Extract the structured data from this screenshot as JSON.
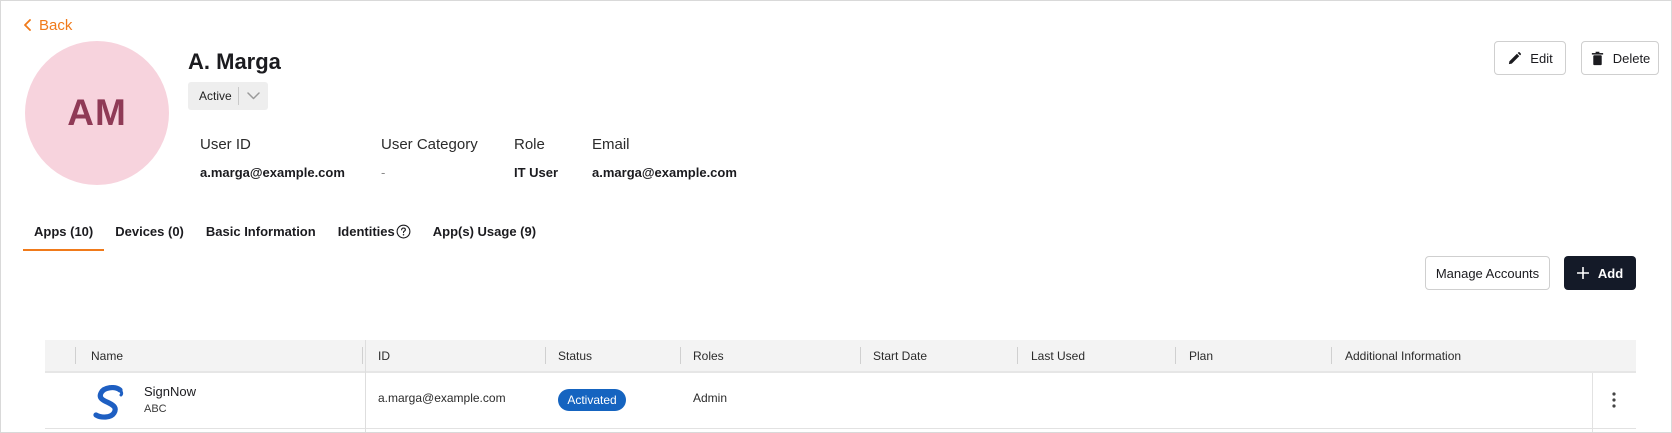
{
  "nav": {
    "back_label": "Back"
  },
  "user": {
    "initials": "AM",
    "name": "A. Marga",
    "status": "Active",
    "fields": [
      {
        "label": "User ID",
        "value": "a.marga@example.com"
      },
      {
        "label": "User Category",
        "value": "-"
      },
      {
        "label": "Role",
        "value": "IT User"
      },
      {
        "label": "Email",
        "value": "a.marga@example.com"
      }
    ]
  },
  "actions": {
    "edit_label": "Edit",
    "delete_label": "Delete"
  },
  "tabs": [
    {
      "label": "Apps (10)",
      "active": true
    },
    {
      "label": "Devices (0)",
      "active": false
    },
    {
      "label": "Basic Information",
      "active": false
    },
    {
      "label": "Identities",
      "active": false,
      "help_icon": "question-circle-icon"
    },
    {
      "label": "App(s) Usage (9)",
      "active": false
    }
  ],
  "toolbar": {
    "manage_label": "Manage Accounts",
    "add_label": "Add"
  },
  "table": {
    "columns": [
      "Name",
      "ID",
      "Status",
      "Roles",
      "Start Date",
      "Last Used",
      "Plan",
      "Additional Information"
    ],
    "rows": [
      {
        "app_name": "SignNow",
        "app_sub": "ABC",
        "id": "a.marga@example.com",
        "status": "Activated",
        "roles": "Admin",
        "start_date": "",
        "last_used": "",
        "plan": "",
        "additional_info": ""
      }
    ]
  },
  "colors": {
    "accent": "#f07a1a",
    "primary_dark": "#141a28",
    "badge_blue": "#1564c0",
    "avatar_bg": "#f7d3dd",
    "avatar_text": "#8f3a56"
  }
}
